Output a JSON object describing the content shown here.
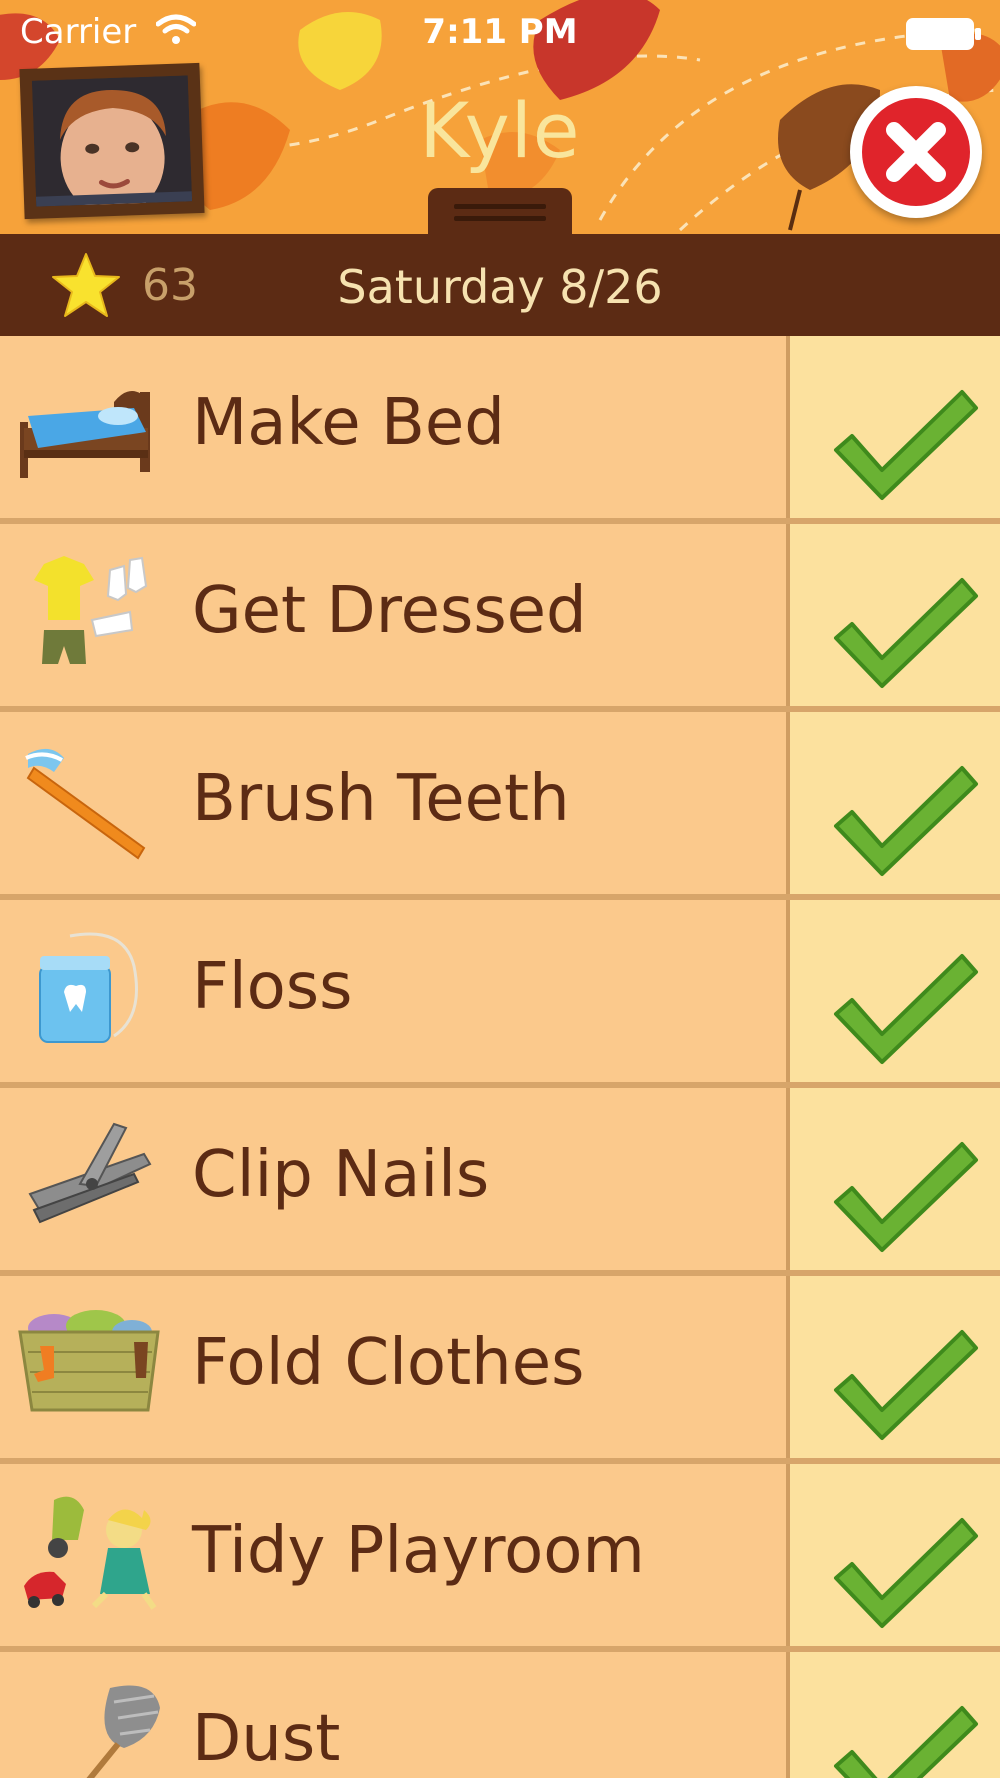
{
  "status_bar": {
    "carrier": "Carrier",
    "time": "7:11 PM"
  },
  "header": {
    "child_name": "Kyle",
    "close_icon": "close-icon"
  },
  "info_bar": {
    "star_count": "63",
    "date": "Saturday 8/26"
  },
  "colors": {
    "header_orange": "#f6a23a",
    "bar_brown": "#5c2b14",
    "row_peach": "#fbc98c",
    "check_cell": "#fce19e",
    "check_green": "#6ab233",
    "close_red": "#e0242b",
    "name_yellow": "#f9e59c"
  },
  "chores": [
    {
      "label": "Make Bed",
      "icon": "bed-icon",
      "done": true
    },
    {
      "label": "Get Dressed",
      "icon": "clothes-icon",
      "done": true
    },
    {
      "label": "Brush Teeth",
      "icon": "toothbrush-icon",
      "done": true
    },
    {
      "label": "Floss",
      "icon": "floss-icon",
      "done": true
    },
    {
      "label": "Clip Nails",
      "icon": "nail-clipper-icon",
      "done": true
    },
    {
      "label": "Fold Clothes",
      "icon": "laundry-basket-icon",
      "done": true
    },
    {
      "label": "Tidy Playroom",
      "icon": "toys-icon",
      "done": true
    },
    {
      "label": "Dust",
      "icon": "feather-duster-icon",
      "done": true
    }
  ]
}
